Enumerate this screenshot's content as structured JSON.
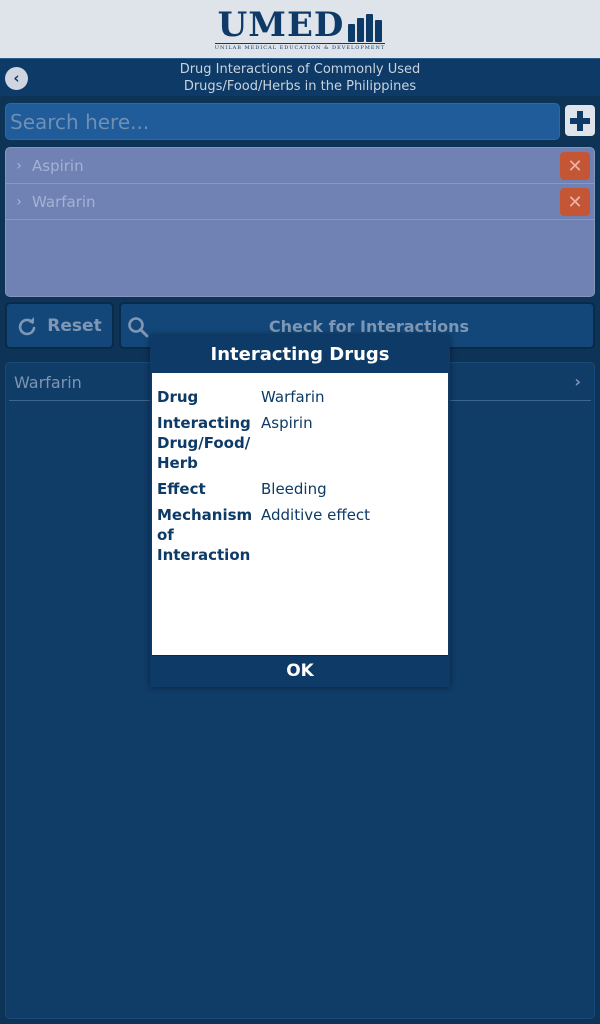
{
  "logo": {
    "text": "UMED",
    "subtitle": "UNILAB MEDICAL EDUCATION & DEVELOPMENT"
  },
  "header": {
    "title_line1": "Drug Interactions of Commonly Used",
    "title_line2": "Drugs/Food/Herbs in the Philippines",
    "back_icon": "chevron-left-icon"
  },
  "search": {
    "placeholder": "Search here...",
    "value": ""
  },
  "selected": [
    {
      "label": "Aspirin"
    },
    {
      "label": "Warfarin"
    }
  ],
  "actions": {
    "reset_label": "Reset",
    "check_label": "Check for Interactions"
  },
  "results": [
    {
      "label": "Warfarin"
    }
  ],
  "dialog": {
    "title": "Interacting Drugs",
    "rows": [
      {
        "key": "Drug",
        "value": "Warfarin"
      },
      {
        "key": "Interacting Drug/Food/ Herb",
        "value": "Aspirin"
      },
      {
        "key": "Effect",
        "value": "Bleeding"
      },
      {
        "key": "Mechanism of Interaction",
        "value": "Additive effect"
      }
    ],
    "ok_label": "OK"
  },
  "colors": {
    "primary": "#0d3a66",
    "background": "#0d3357",
    "remove": "#c45535",
    "list_bg": "#6f82b3"
  }
}
